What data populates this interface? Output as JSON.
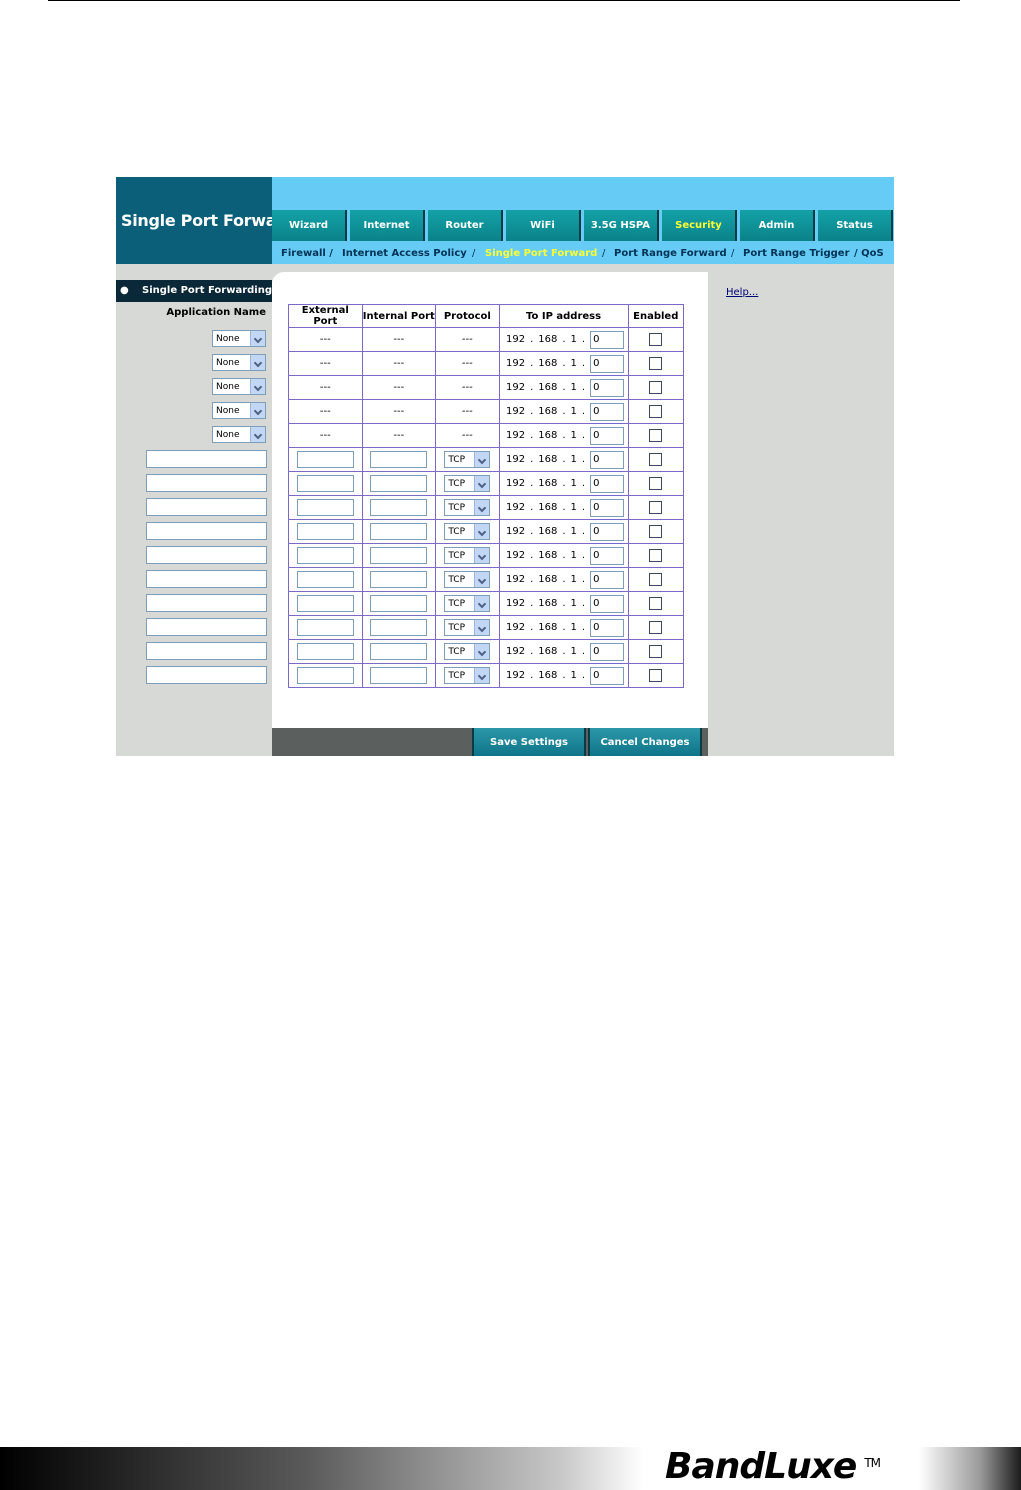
{
  "brand": {
    "title": "Single Port Forward"
  },
  "tabs": [
    {
      "label": "Wizard",
      "active": false
    },
    {
      "label": "Internet",
      "active": false
    },
    {
      "label": "Router",
      "active": false
    },
    {
      "label": "WiFi",
      "active": false
    },
    {
      "label": "3.5G HSPA",
      "active": false
    },
    {
      "label": "Security",
      "active": true
    },
    {
      "label": "Admin",
      "active": false
    },
    {
      "label": "Status",
      "active": false
    }
  ],
  "subnav": {
    "items": [
      {
        "label": "Firewall /",
        "active": false
      },
      {
        "label": "Internet Access Policy",
        "active": false
      },
      {
        "label": "Single Port Forward",
        "active": true
      },
      {
        "label": "Port Range Forward",
        "active": false
      },
      {
        "label": "Port Range Trigger",
        "active": false
      },
      {
        "label": "/ QoS",
        "active": false
      }
    ],
    "separator": "/"
  },
  "sidebar": {
    "section": "Single Port Forwarding",
    "bullet": "●",
    "app_name_label": "Application Name",
    "app_selects": [
      "None",
      "None",
      "None",
      "None",
      "None"
    ]
  },
  "table": {
    "headers": [
      "External Port",
      "Internal Port",
      "Protocol",
      "To IP address",
      "Enabled"
    ],
    "fixed_placeholder": "---",
    "ip_prefix": [
      "192",
      "168",
      "1"
    ],
    "ip_dot": ".",
    "last_octet": "0",
    "protocol_default": "TCP"
  },
  "help_link": "Help...",
  "buttons": {
    "save": "Save Settings",
    "cancel": "Cancel Changes"
  },
  "footer": {
    "logo": "BandLuxe",
    "tm": "TM"
  },
  "colors": {
    "brand_bg": "#0b5f78",
    "tab_active_text": "#ffff33",
    "topbar": "#66ccf5"
  }
}
